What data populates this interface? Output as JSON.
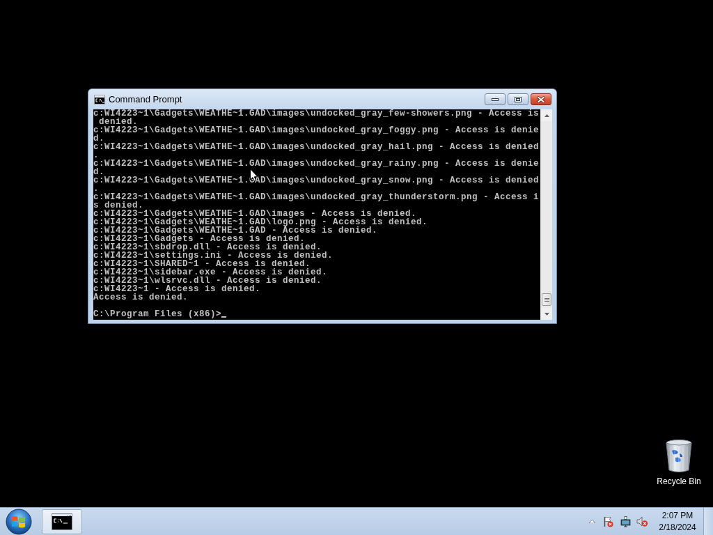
{
  "window": {
    "title": "Command Prompt",
    "console_lines": [
      "c:WI4223~1\\Gadgets\\WEATHE~1.GAD\\images\\undocked_gray_few-showers.png - Access is",
      " denied.",
      "c:WI4223~1\\Gadgets\\WEATHE~1.GAD\\images\\undocked_gray_foggy.png - Access is denie",
      "d.",
      "c:WI4223~1\\Gadgets\\WEATHE~1.GAD\\images\\undocked_gray_hail.png - Access is denied",
      ".",
      "c:WI4223~1\\Gadgets\\WEATHE~1.GAD\\images\\undocked_gray_rainy.png - Access is denie",
      "d.",
      "c:WI4223~1\\Gadgets\\WEATHE~1.GAD\\images\\undocked_gray_snow.png - Access is denied",
      ".",
      "c:WI4223~1\\Gadgets\\WEATHE~1.GAD\\images\\undocked_gray_thunderstorm.png - Access i",
      "s denied.",
      "c:WI4223~1\\Gadgets\\WEATHE~1.GAD\\images - Access is denied.",
      "c:WI4223~1\\Gadgets\\WEATHE~1.GAD\\logo.png - Access is denied.",
      "c:WI4223~1\\Gadgets\\WEATHE~1.GAD - Access is denied.",
      "c:WI4223~1\\Gadgets - Access is denied.",
      "c:WI4223~1\\sbdrop.dll - Access is denied.",
      "c:WI4223~1\\settings.ini - Access is denied.",
      "c:WI4223~1\\SHARED~1 - Access is denied.",
      "c:WI4223~1\\sidebar.exe - Access is denied.",
      "c:WI4223~1\\wlsrvc.dll - Access is denied.",
      "c:WI4223~1 - Access is denied.",
      "Access is denied."
    ],
    "prompt": "C:\\Program Files (x86)>"
  },
  "desktop_icons": [
    {
      "label": "Recycle Bin"
    }
  ],
  "taskbar": {
    "tasks": [
      {
        "selected": true
      }
    ],
    "clock": {
      "time": "2:07 PM",
      "date": "2/18/2024"
    }
  }
}
